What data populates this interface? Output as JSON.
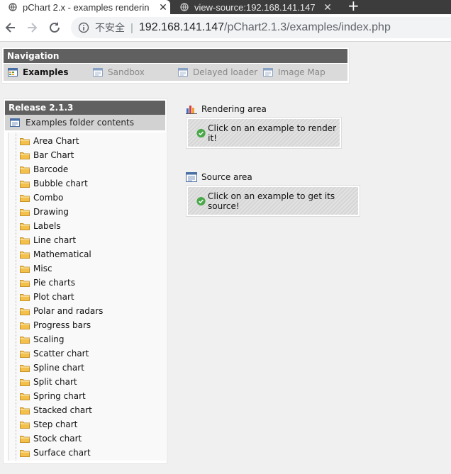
{
  "browser": {
    "tabs": [
      {
        "title": "pChart 2.x - examples renderin",
        "active": true
      },
      {
        "title": "view-source:192.168.141.147",
        "active": false
      }
    ],
    "new_tab_label": "+",
    "close_glyph": "✕",
    "address": {
      "security_label": "不安全",
      "separator": "|",
      "host": "192.168.141.147",
      "path": "/pChart2.1.3/examples/index.php"
    },
    "icons": [
      "back-arrow-icon",
      "forward-arrow-icon",
      "reload-icon",
      "info-icon",
      "globe-icon"
    ]
  },
  "navigation": {
    "title": "Navigation",
    "items": [
      {
        "label": "Examples",
        "active": true
      },
      {
        "label": "Sandbox",
        "active": false
      },
      {
        "label": "Delayed loader",
        "active": false
      },
      {
        "label": "Image Map",
        "active": false
      }
    ]
  },
  "release": {
    "title": "Release 2.1.3",
    "root_label": "Examples folder contents",
    "folders": [
      "Area Chart",
      "Bar Chart",
      "Barcode",
      "Bubble chart",
      "Combo",
      "Drawing",
      "Labels",
      "Line chart",
      "Mathematical",
      "Misc",
      "Pie charts",
      "Plot chart",
      "Polar and radars",
      "Progress bars",
      "Scaling",
      "Scatter chart",
      "Spline chart",
      "Split chart",
      "Spring chart",
      "Stacked chart",
      "Step chart",
      "Stock chart",
      "Surface chart"
    ]
  },
  "rendering": {
    "title": "Rendering area",
    "message": "Click on an example to render it!"
  },
  "source": {
    "title": "Source area",
    "message": "Click on an example to get its source!"
  },
  "colors": {
    "panel_header": "#606060",
    "page_background": "#f0f0f0",
    "folder": "#f3c14b",
    "check": "#4aa84a"
  }
}
